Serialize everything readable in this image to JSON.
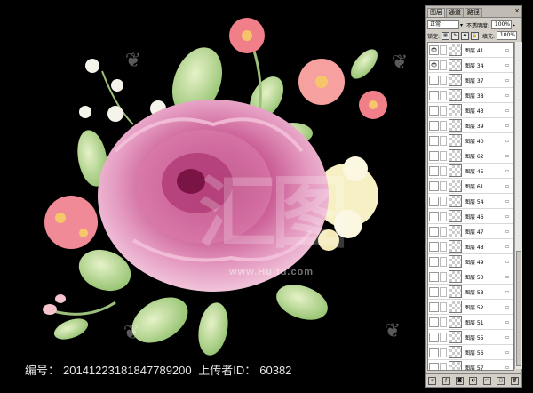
{
  "caption": {
    "id_label": "编号：",
    "id_value": "20141223181847789200",
    "uploader_label": "上传者ID：",
    "uploader_value": "60382"
  },
  "watermark": {
    "text": "汇图",
    "url": "www.Huitu.com"
  },
  "panel": {
    "tabs": [
      "图层",
      "通道",
      "路径"
    ],
    "close": "×",
    "blend_mode": "正常",
    "opacity_label": "不透明度:",
    "opacity_value": "100%",
    "lock_label": "锁定:",
    "fill_label": "填充:",
    "fill_value": "100%",
    "layers": [
      "图层 41",
      "图层 34",
      "图层 37",
      "图层 38",
      "图层 43",
      "图层 39",
      "图层 40",
      "图层 62",
      "图层 45",
      "图层 61",
      "图层 54",
      "图层 46",
      "图层 47",
      "图层 48",
      "图层 49",
      "图层 50",
      "图层 53",
      "图层 52",
      "图层 51",
      "图层 55",
      "图层 56",
      "图层 57"
    ],
    "footer_icons": [
      "link-icon",
      "fx-icon",
      "mask-icon",
      "adjust-icon",
      "folder-icon",
      "new-layer-icon",
      "trash-icon"
    ]
  }
}
